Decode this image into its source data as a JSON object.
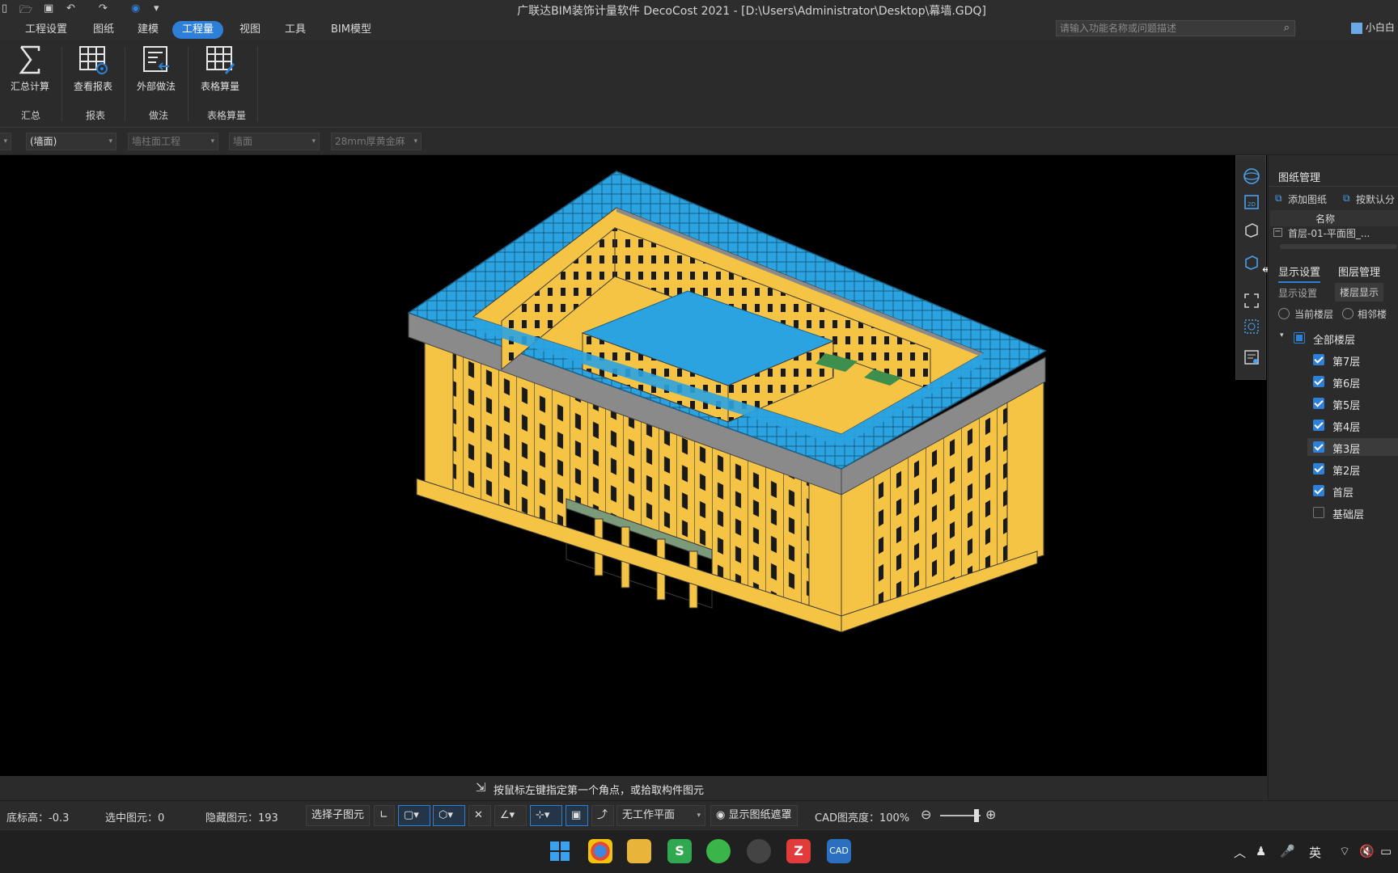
{
  "window": {
    "title": "广联达BIM装饰计量软件 DecoCost 2021 - [D:\\Users\\Administrator\\Desktop\\幕墙.GDQ]"
  },
  "menu": {
    "items": [
      "工程设置",
      "图纸",
      "建模",
      "工程量",
      "视图",
      "工具",
      "BIM模型"
    ],
    "active": "工程量",
    "search_placeholder": "请输入功能名称或问题描述",
    "user": "小白白"
  },
  "ribbon": {
    "buttons": [
      {
        "label": "汇总计算",
        "icon": "sigma-icon"
      },
      {
        "label": "查看报表",
        "icon": "report-view-icon"
      },
      {
        "label": "外部做法",
        "icon": "external-method-icon"
      },
      {
        "label": "表格算量",
        "icon": "table-calc-icon"
      }
    ],
    "groups": [
      "汇总",
      "报表",
      "做法",
      "表格算量"
    ]
  },
  "subbar": {
    "dropdowns": [
      "(墙面)",
      "墙柱面工程",
      "墙面",
      "28mm厚黄金麻"
    ]
  },
  "right_panel": {
    "drawing_title": "图纸管理",
    "add_drawing": "添加图纸",
    "default_split": "按默认分",
    "name_header": "名称",
    "drawing_item": "首层-01-平面图_...",
    "tabs": [
      "显示设置",
      "图层管理"
    ],
    "subtabs": [
      "显示设置",
      "楼层显示"
    ],
    "radios": [
      "当前楼层",
      "相邻楼"
    ],
    "all_floors": "全部楼层",
    "floors": [
      {
        "name": "第7层",
        "checked": true
      },
      {
        "name": "第6层",
        "checked": true
      },
      {
        "name": "第5层",
        "checked": true
      },
      {
        "name": "第4层",
        "checked": true
      },
      {
        "name": "第3层",
        "checked": true
      },
      {
        "name": "第2层",
        "checked": true
      },
      {
        "name": "首层",
        "checked": true
      },
      {
        "name": "基础层",
        "checked": false
      }
    ]
  },
  "hint": "按鼠标左键指定第一个角点，或拾取构件图元",
  "status": {
    "base_elev": "底标高：-0.3",
    "selected": "选中图元：0",
    "hidden": "隐藏图元：193",
    "select_child": "选择子图元",
    "plane": "无工作平面",
    "show_mask": "显示图纸遮罩",
    "cad_brightness": "CAD图亮度：100%"
  },
  "taskbar": {
    "ime": "英"
  },
  "colors": {
    "accent": "#2e7fd8",
    "building_wall": "#f6c445",
    "roof": "#2aa3e0",
    "parapet": "#8a8a8a"
  }
}
